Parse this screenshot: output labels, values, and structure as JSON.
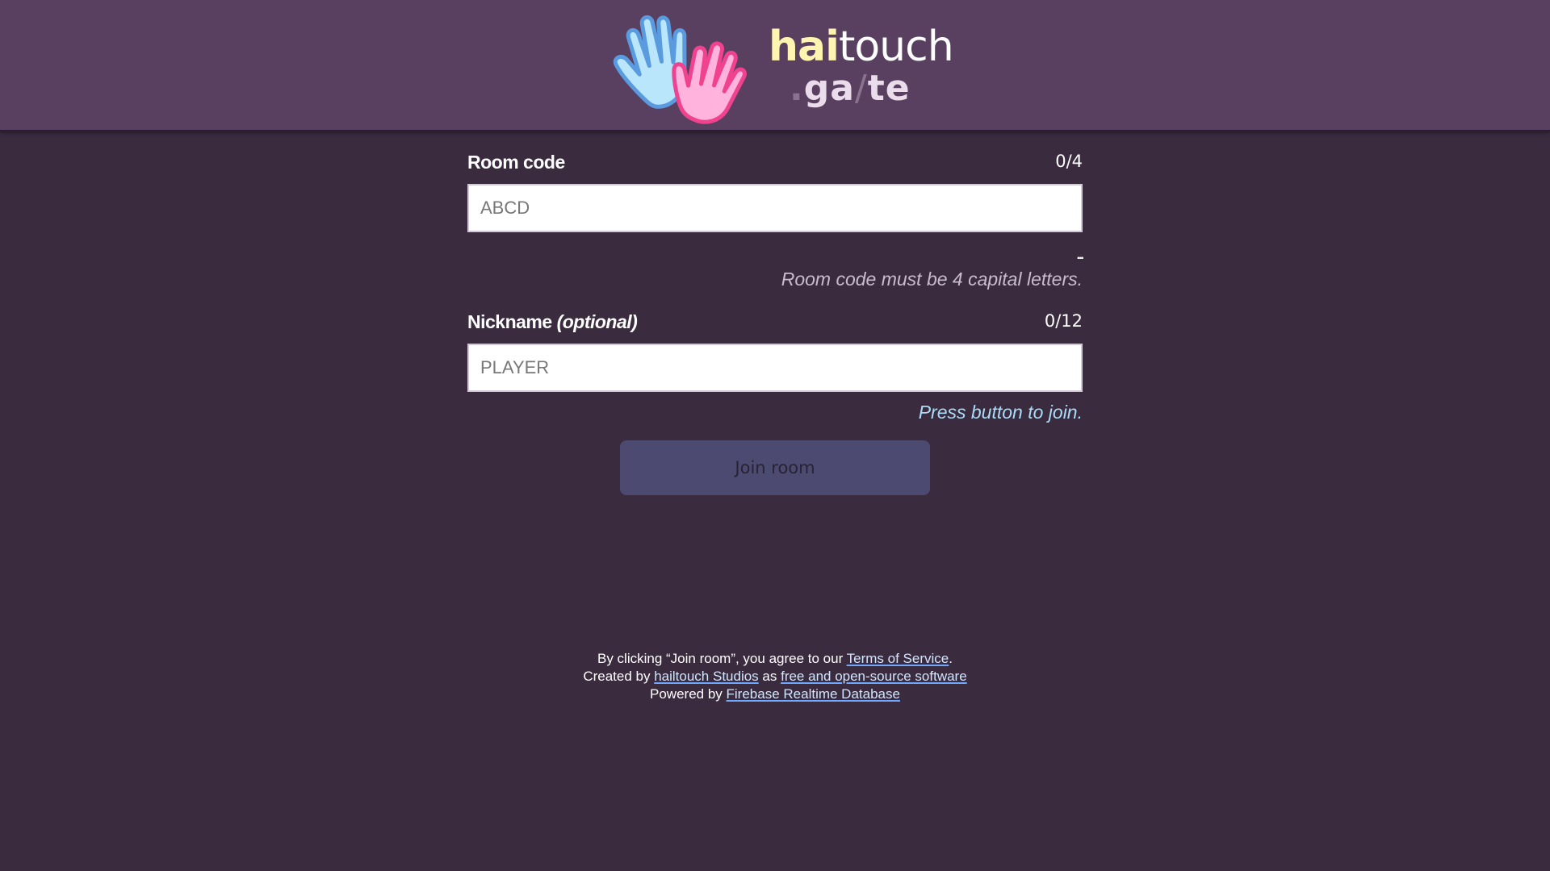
{
  "header": {
    "logo": {
      "word_hai": "hai",
      "word_touch": "touch",
      "sub_dot": ".",
      "sub_ga": "ga",
      "sub_slash": "/",
      "sub_te": "te",
      "colors": {
        "left_hand": "#b9e6fb",
        "right_hand": "#ffb3dd",
        "hai_text": "#fff4b0"
      }
    }
  },
  "room_code": {
    "label": "Room code",
    "counter": "0/4",
    "placeholder": "ABCD",
    "value": "",
    "ellipsis": "...",
    "validation_message": "Room code must be 4 capital letters."
  },
  "nickname": {
    "label": "Nickname",
    "label_suffix": "(optional)",
    "counter": "0/12",
    "placeholder": "PLAYER",
    "value": "",
    "status_message": "Press button to join."
  },
  "join_button": {
    "label": "Join room"
  },
  "footer": {
    "line1_prefix": "By clicking “Join room”, you agree to our ",
    "terms_link": "Terms of Service",
    "line1_suffix": ".",
    "line2_prefix": "Created by ",
    "studio_link": "hailtouch Studios",
    "line2_mid": " as ",
    "oss_link": "free and open-source software",
    "line3_prefix": "Powered by ",
    "firebase_link": "Firebase Realtime Database"
  },
  "colors": {
    "background": "#3a2b3f",
    "header": "#5a4060",
    "button": "#4d4a72",
    "hint_ok": "#a9dcf7",
    "hint_error": "#c8bccd"
  }
}
